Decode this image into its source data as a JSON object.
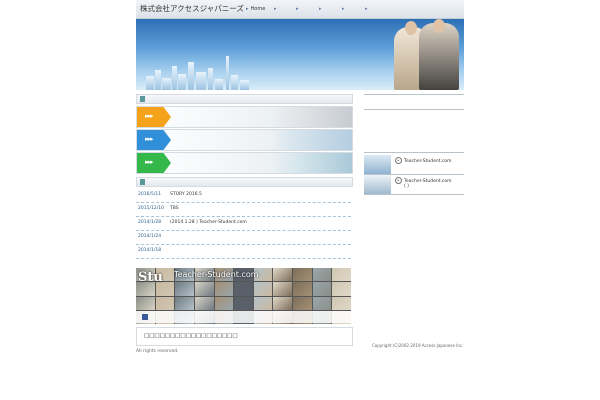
{
  "header": {
    "brand": "株式会社アクセスジャパニーズ",
    "nav": [
      {
        "label": "Home"
      },
      {
        "label": ""
      },
      {
        "label": ""
      },
      {
        "label": ""
      },
      {
        "label": ""
      },
      {
        "label": ""
      }
    ]
  },
  "banners": [
    {
      "arrow": "▸▸▸",
      "color": "#f3a21a"
    },
    {
      "arrow": "▸▸▸",
      "color": "#2f8fd8"
    },
    {
      "arrow": "▸▸▸",
      "color": "#35b84a"
    }
  ],
  "news": [
    {
      "date": "2016/5/11",
      "text": "STORY 2016.5"
    },
    {
      "date": "2015/12/10",
      "text": "TBS"
    },
    {
      "date": "2014/1/28",
      "text": "(2014.1.28 ) Teacher-Student.com"
    },
    {
      "date": "2014/1/24",
      "text": ""
    },
    {
      "date": "2014/1/18",
      "text": ""
    }
  ],
  "right_links": [
    {
      "text": "Teacher-Student.com",
      "sub": ""
    },
    {
      "text": "Teacher-Student.com",
      "sub": "(  )"
    }
  ],
  "mosaic": {
    "overlay_big": "Stu",
    "overlay_small": "Teacher-Student.com"
  },
  "caption": "□□□□□□□□□□□□□□□□□□",
  "copyright": "Copyright (C)2002-2019 Access Japanese Inc.",
  "all_rights": "All rights reserved."
}
